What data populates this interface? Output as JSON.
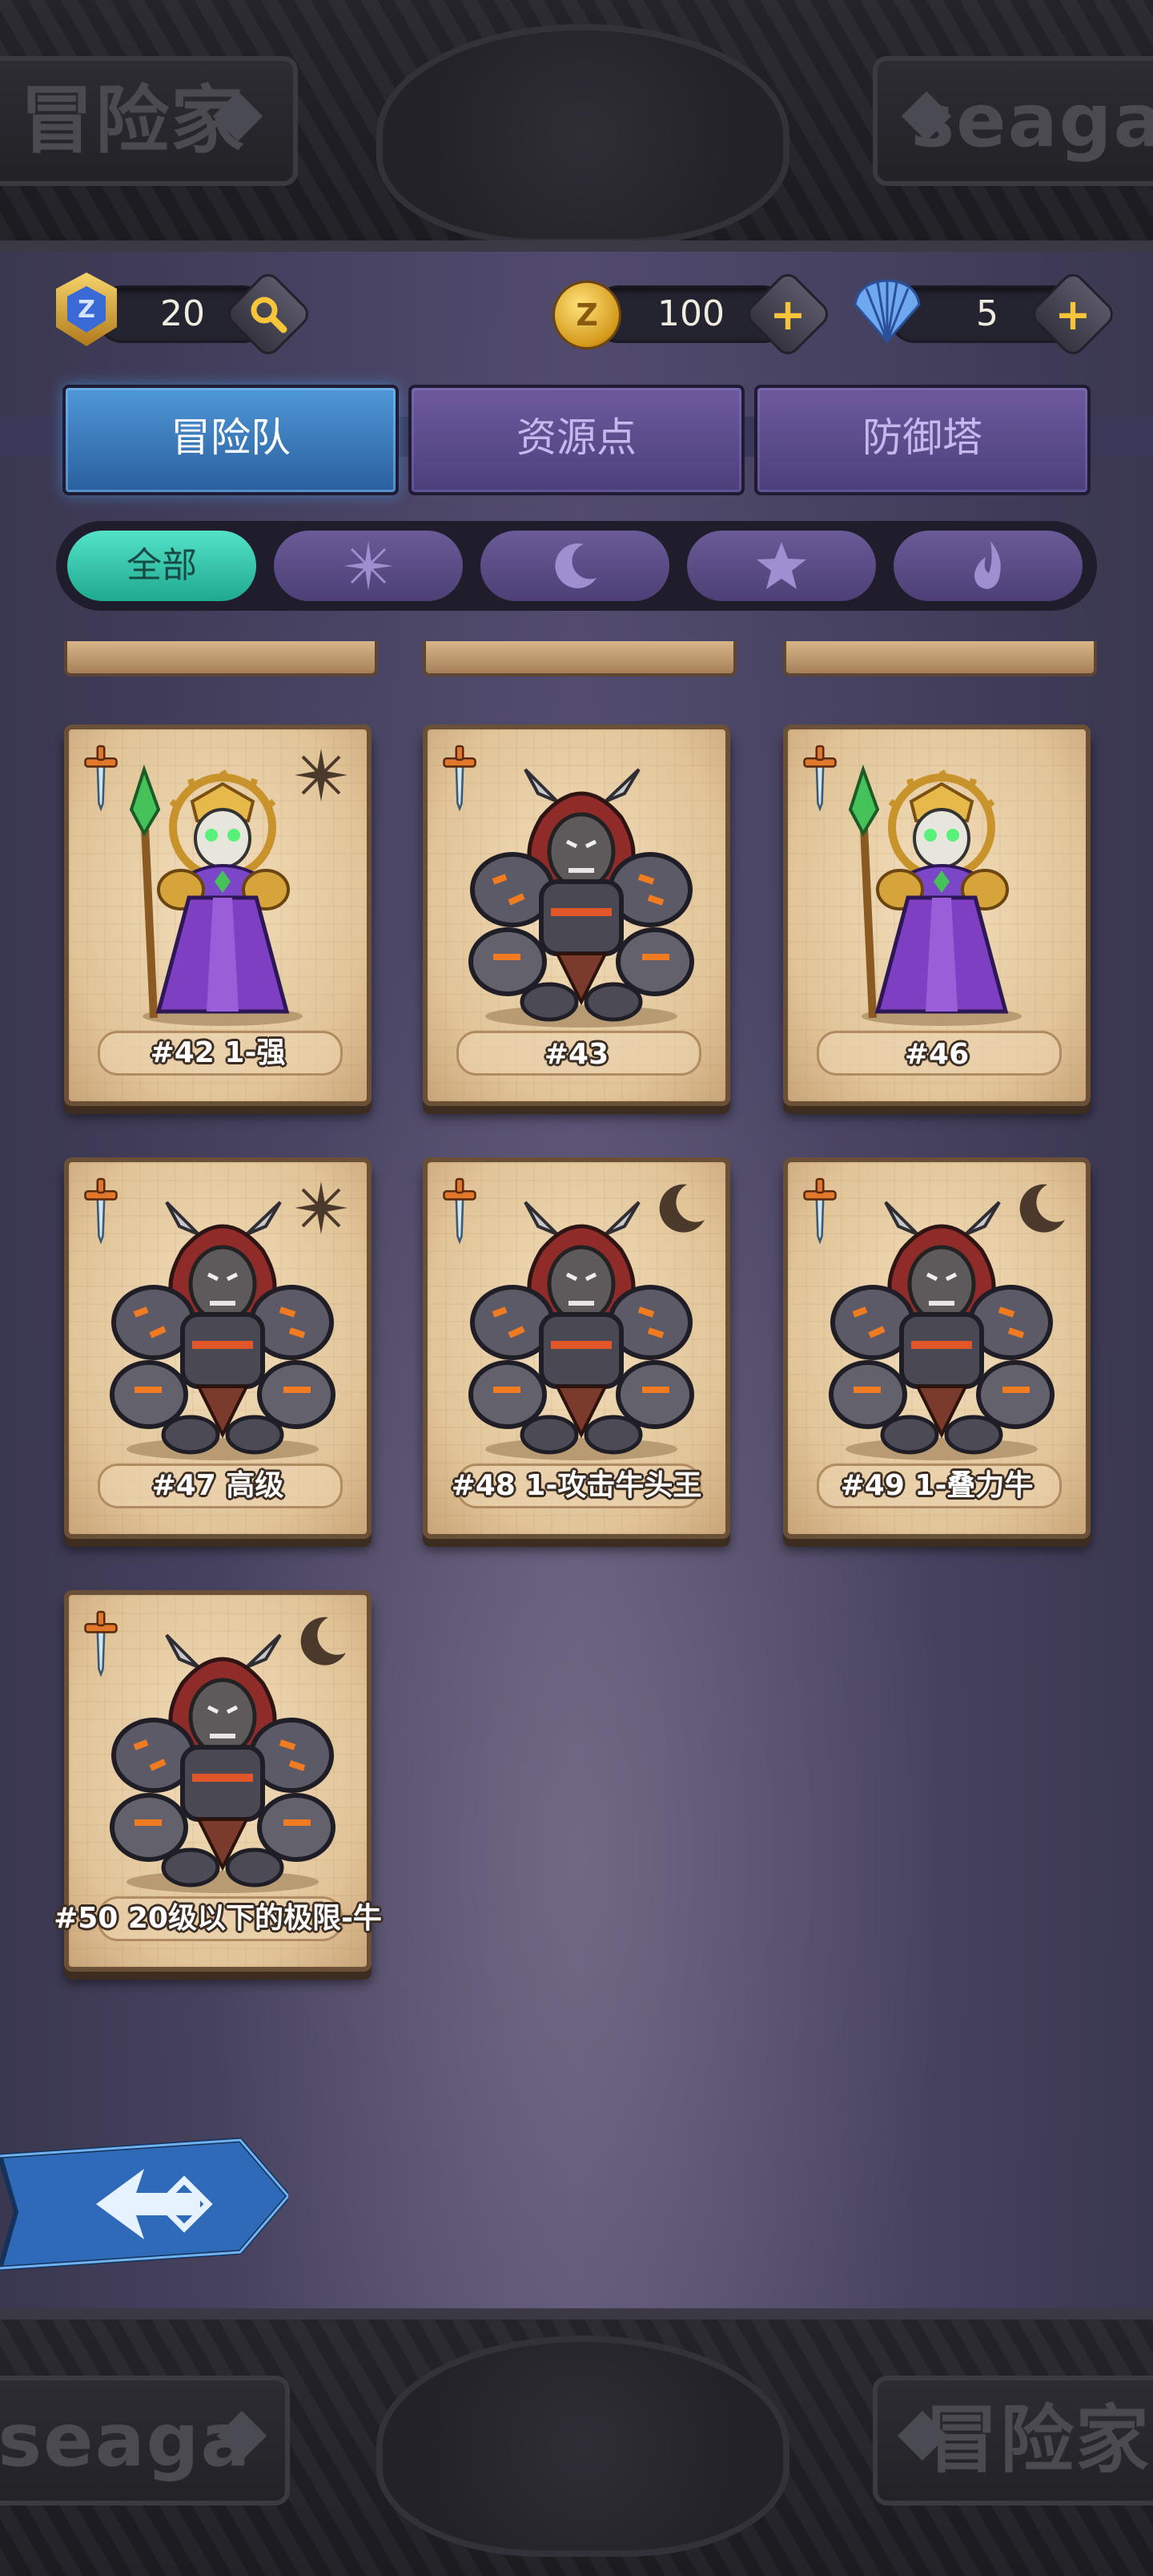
{
  "header": {
    "level": "20",
    "gold": "100",
    "shells": "5",
    "watermark_left": "冒险家",
    "watermark_right": "seaga",
    "bottom_watermark_left": "seaga",
    "bottom_watermark_right": "冒险家"
  },
  "tabs": [
    {
      "label": "冒险队",
      "active": true
    },
    {
      "label": "资源点",
      "active": false
    },
    {
      "label": "防御塔",
      "active": false
    }
  ],
  "filters": [
    {
      "label": "全部",
      "icon": "all",
      "active": true
    },
    {
      "label": "",
      "icon": "sparkle-icon"
    },
    {
      "label": "",
      "icon": "moon-icon"
    },
    {
      "label": "",
      "icon": "star-icon"
    },
    {
      "label": "",
      "icon": "flame-icon"
    }
  ],
  "cards": [
    {
      "name": "#42 1-强",
      "hero": "skeleton-priest",
      "element": "sparkle"
    },
    {
      "name": "#43",
      "hero": "minotaur",
      "element": ""
    },
    {
      "name": "#46",
      "hero": "skeleton-priest",
      "element": ""
    },
    {
      "name": "#47 高级",
      "hero": "minotaur",
      "element": "sparkle"
    },
    {
      "name": "#48 1-攻击牛头王",
      "hero": "minotaur",
      "element": "moon"
    },
    {
      "name": "#49 1-叠力牛",
      "hero": "minotaur",
      "element": "moon"
    },
    {
      "name": "#50 20级以下的极限-牛",
      "hero": "minotaur",
      "element": "moon"
    }
  ],
  "colors": {
    "tab_active": "#2f70b6",
    "tab_inactive": "#574786",
    "filter_active": "#2cc6ab",
    "card_parchment": "#e6cda3"
  }
}
